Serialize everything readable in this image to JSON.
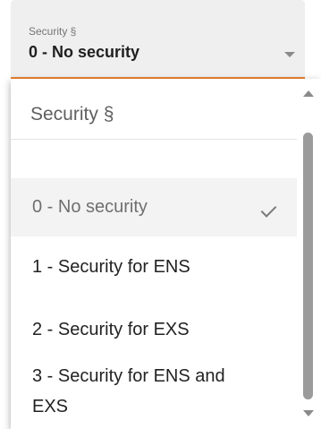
{
  "field": {
    "label": "Security §",
    "value": "0 - No security"
  },
  "dropdown": {
    "header": "Security §",
    "options": [
      {
        "label": "0 - No security",
        "selected": true
      },
      {
        "label": "1 - Security for ENS",
        "selected": false
      },
      {
        "label": "2 - Security for EXS",
        "selected": false
      },
      {
        "label_line1": "3 - Security for ENS and",
        "label_line2": "EXS",
        "selected": false
      }
    ]
  },
  "colors": {
    "accent": "#e8822e",
    "field_bg": "#efefef",
    "selected_bg": "#f3f3f3"
  }
}
